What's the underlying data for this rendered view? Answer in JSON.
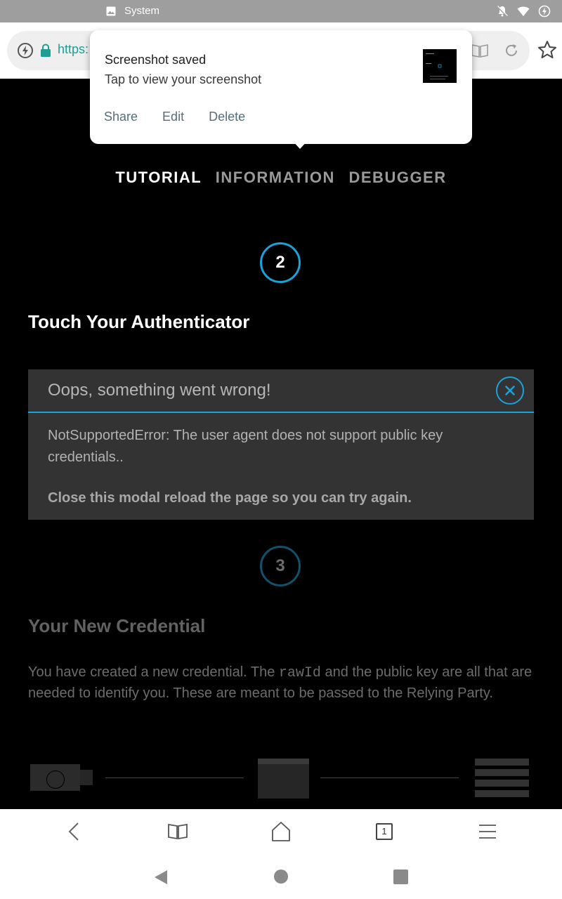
{
  "statusbar": {
    "notification_label": "System"
  },
  "browser": {
    "url_text": "https:"
  },
  "page": {
    "tabs": [
      {
        "label": "TUTORIAL",
        "active": true
      },
      {
        "label": "INFORMATION",
        "active": false
      },
      {
        "label": "DEBUGGER",
        "active": false
      }
    ],
    "step2_number": "2",
    "step2_heading": "Touch Your Authenticator",
    "modal": {
      "title": "Oops, something went wrong!",
      "message": "NotSupportedError: The user agent does not support public key credentials..",
      "footer": "Close this modal reload the page so you can try again."
    },
    "step3_number": "3",
    "step3_heading": "Your New Credential",
    "step3_text_before": "You have created a new credential. The ",
    "step3_code": "rawId",
    "step3_text_after": " and the public key are all that are needed to identify you. These are meant to be passed to the Relying Party."
  },
  "notification": {
    "title": "Screenshot saved",
    "subtitle": "Tap to view your screenshot",
    "actions": [
      "Share",
      "Edit",
      "Delete"
    ]
  },
  "bottom_nav": {
    "tab_count": "1"
  },
  "colors": {
    "accent": "#1aa3d9",
    "url_green": "#1e9e93",
    "notif_action": "#546e7a"
  }
}
